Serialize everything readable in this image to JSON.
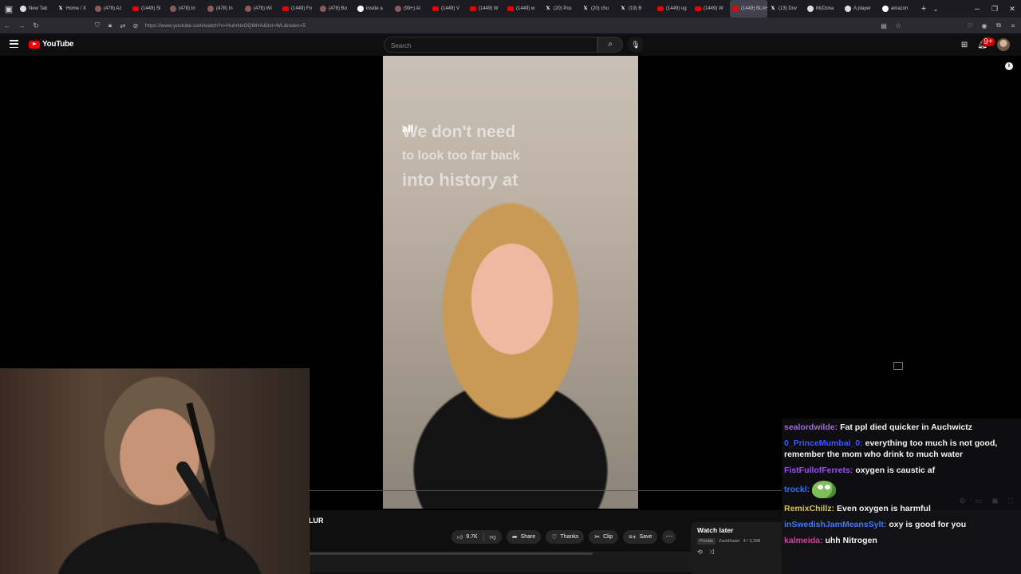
{
  "browser": {
    "tabs": [
      {
        "fav": "wiki",
        "title": "New Tab"
      },
      {
        "fav": "x",
        "title": "Home / X"
      },
      {
        "fav": "av",
        "title": "(478) Az"
      },
      {
        "fav": "yt",
        "title": "(1449) Sl"
      },
      {
        "fav": "av",
        "title": "(478) In"
      },
      {
        "fav": "av",
        "title": "(478) In"
      },
      {
        "fav": "av",
        "title": "(478) Wi"
      },
      {
        "fav": "yt",
        "title": "(1449) Fo"
      },
      {
        "fav": "av",
        "title": "(478) Bo"
      },
      {
        "fav": "g",
        "title": "inside a"
      },
      {
        "fav": "av",
        "title": "(99+) Al"
      },
      {
        "fav": "yt",
        "title": "(1449) V"
      },
      {
        "fav": "yt",
        "title": "(1449) W"
      },
      {
        "fav": "yt",
        "title": "(1449) w"
      },
      {
        "fav": "x",
        "title": "(20) Pos"
      },
      {
        "fav": "x",
        "title": "(20) chu"
      },
      {
        "fav": "x",
        "title": "(19) B"
      },
      {
        "fav": "yt",
        "title": "(1449) ug"
      },
      {
        "fav": "yt",
        "title": "(1449) W"
      },
      {
        "fav": "yt",
        "title": "(1449) BLAH...",
        "active": true
      },
      {
        "fav": "x",
        "title": "(13) Dov"
      },
      {
        "fav": "wiki",
        "title": "McDona"
      },
      {
        "fav": "wiki",
        "title": "A player"
      },
      {
        "fav": "g",
        "title": "amazon"
      }
    ],
    "url": "https://www.youtube.com/watch?v=HumNxOQ8IHA&list=WL&index=5"
  },
  "youtube": {
    "logo_text": "YouTube",
    "search_placeholder": "Search",
    "notification_count": "9+"
  },
  "video": {
    "caption_small": "all",
    "caption_lines": [
      "We don't need",
      "to look too far back",
      "into history at"
    ],
    "title_fragment": "LUR",
    "likes": "9.7K",
    "actions": {
      "share": "Share",
      "thanks": "Thanks",
      "clip": "Clip",
      "save": "Save"
    }
  },
  "watch_later": {
    "title": "Watch later",
    "privacy": "Private",
    "owner": "ZackRawrr",
    "position": "4 / 3,398"
  },
  "chat": {
    "messages": [
      {
        "user": "sealordwilde:",
        "color": "#a06bd9",
        "text": "Fat ppl died quicker in Auchwictz"
      },
      {
        "user": "0_PrinceMumbai_0:",
        "color": "#3a56ff",
        "text": "everything too much is not good, remember the mom who drink to much water"
      },
      {
        "user": "FistFullofFerrets:",
        "color": "#9b4dff",
        "text": "oxygen is caustic af"
      },
      {
        "user": "trockl:",
        "color": "#2f6fff",
        "text": "",
        "emote": true
      },
      {
        "user": "RemixChillz:",
        "color": "#d9c25a",
        "text": "Even oxygen is harmful"
      },
      {
        "user": "inSwedishJamMeansSylt:",
        "color": "#3a7bff",
        "text": "oxy is good for you"
      },
      {
        "user": "kalmeida:",
        "color": "#d040a0",
        "text": "uhh Nitrogen"
      }
    ]
  }
}
